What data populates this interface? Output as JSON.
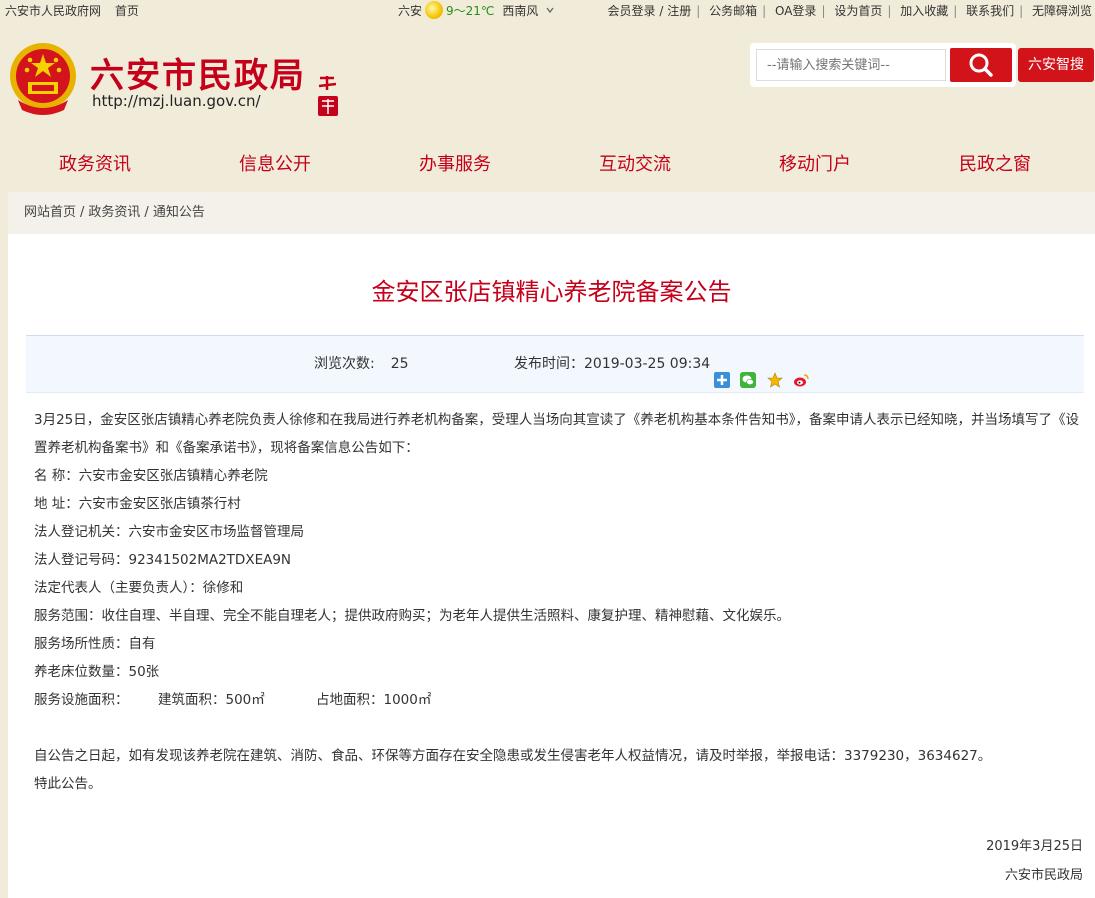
{
  "topbar": {
    "site_link": "六安市人民政府网",
    "home_link": "首页",
    "city": "六安",
    "weather_temp": "9～21℃",
    "wind": "西南风",
    "links": [
      "会员登录 / 注册",
      "公务邮箱",
      "OA登录",
      "设为首页",
      "加入收藏",
      "联系我们",
      "无障碍浏览"
    ]
  },
  "header": {
    "title": "六安市民政局",
    "url": "http://mzj.luan.gov.cn/",
    "search_placeholder": "--请输入搜索关键词--",
    "smart_search": "六安智搜"
  },
  "nav": [
    "政务资讯",
    "信息公开",
    "办事服务",
    "互动交流",
    "移动门户",
    "民政之窗"
  ],
  "breadcrumb": [
    "网站首页",
    "政务资讯",
    "通知公告"
  ],
  "article": {
    "title": "金安区张店镇精心养老院备案公告",
    "views_label": "浏览次数:",
    "views": "25",
    "date_label": "发布时间：",
    "date": "2019-03-25 09:34",
    "intro": "3月25日，金安区张店镇精心养老院负责人徐修和在我局进行养老机构备案，受理人当场向其宣读了《养老机构基本条件告知书》，备案申请人表示已经知晓，并当场填写了《设置养老机构备案书》和《备案承诺书》，现将备案信息公告如下：",
    "fields": [
      "名  称：六安市金安区张店镇精心养老院",
      "地  址：六安市金安区张店镇茶行村",
      "法人登记机关：六安市金安区市场监督管理局",
      "法人登记号码：92341502MA2TDXEA9N",
      "法定代表人（主要负责人）：徐修和",
      "服务范围：收住自理、半自理、完全不能自理老人；提供政府购买；为老年人提供生活照料、康复护理、精神慰藉、文化娱乐。",
      "服务场所性质：自有",
      "养老床位数量：50张"
    ],
    "area_label": "服务设施面积：",
    "building_area": "建筑面积：500㎡",
    "land_area": "占地面积：1000㎡",
    "notice": "自公告之日起，如有发现该养老院在建筑、消防、食品、环保等方面存在安全隐患或发生侵害老年人权益情况，请及时举报，举报电话：3379230，3634627。",
    "closing": "特此公告。",
    "sign_date": "2019年3月25日",
    "sign_org": "六安市民政局"
  },
  "colors": {
    "accent": "#c4001a",
    "button": "#d3131a"
  }
}
